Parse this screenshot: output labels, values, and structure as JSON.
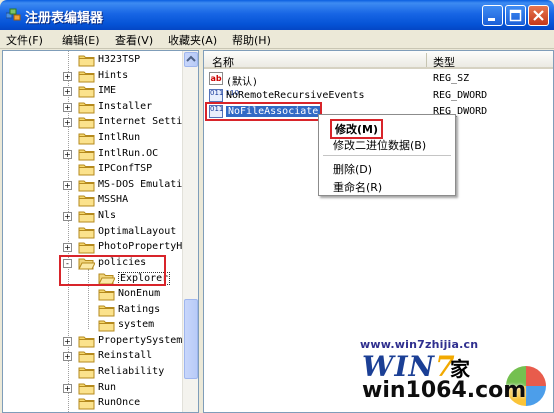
{
  "window": {
    "title": "注册表编辑器",
    "colors": {
      "title_bar": "#0a5fe0",
      "highlight_box": "#d8242a",
      "face": "#ece9d8"
    }
  },
  "menu": {
    "items": [
      {
        "label": "文件(F)"
      },
      {
        "label": "编辑(E)"
      },
      {
        "label": "查看(V)"
      },
      {
        "label": "收藏夹(A)"
      },
      {
        "label": "帮助(H)"
      }
    ]
  },
  "tree": {
    "items": [
      {
        "label": "H323TSP",
        "expander": "",
        "indent": 0
      },
      {
        "label": "Hints",
        "expander": "+",
        "indent": 0
      },
      {
        "label": "IME",
        "expander": "+",
        "indent": 0
      },
      {
        "label": "Installer",
        "expander": "+",
        "indent": 0
      },
      {
        "label": "Internet Setti",
        "expander": "+",
        "indent": 0
      },
      {
        "label": "IntlRun",
        "expander": "",
        "indent": 0
      },
      {
        "label": "IntlRun.OC",
        "expander": "+",
        "indent": 0
      },
      {
        "label": "IPConfTSP",
        "expander": "",
        "indent": 0
      },
      {
        "label": "MS-DOS Emulati",
        "expander": "+",
        "indent": 0
      },
      {
        "label": "MSSHA",
        "expander": "",
        "indent": 0
      },
      {
        "label": "Nls",
        "expander": "+",
        "indent": 0
      },
      {
        "label": "OptimalLayout",
        "expander": "",
        "indent": 0
      },
      {
        "label": "PhotoPropertyH",
        "expander": "+",
        "indent": 0
      },
      {
        "label": "policies",
        "expander": "-",
        "indent": 0,
        "open": true
      },
      {
        "label": "Explorer",
        "expander": "",
        "indent": 1,
        "selected": true,
        "open": true
      },
      {
        "label": "NonEnum",
        "expander": "",
        "indent": 1
      },
      {
        "label": "Ratings",
        "expander": "",
        "indent": 1
      },
      {
        "label": "system",
        "expander": "",
        "indent": 1
      },
      {
        "label": "PropertySystem",
        "expander": "+",
        "indent": 0
      },
      {
        "label": "Reinstall",
        "expander": "+",
        "indent": 0
      },
      {
        "label": "Reliability",
        "expander": "",
        "indent": 0
      },
      {
        "label": "Run",
        "expander": "+",
        "indent": 0
      },
      {
        "label": "RunOnce",
        "expander": "",
        "indent": 0
      }
    ]
  },
  "list": {
    "headers": {
      "name": "名称",
      "type": "类型"
    },
    "rows": [
      {
        "icon": "string-value-icon",
        "name": "(默认)",
        "type": "REG_SZ"
      },
      {
        "icon": "binary-value-icon",
        "name": "NoRemoteRecursiveEvents",
        "type": "REG_DWORD"
      },
      {
        "icon": "binary-value-icon",
        "name": "NoFileAssociate",
        "type": "REG_DWORD",
        "selected": true
      }
    ]
  },
  "context_menu": {
    "modify": "修改(M)",
    "modify_binary": "修改二进位数据(B)",
    "delete": "删除(D)",
    "rename": "重命名(R)"
  },
  "watermark": {
    "url": "www.win7zhijia.cn",
    "logo_prefix": "WIN",
    "logo_digit": "7",
    "logo_suffix": "家",
    "site": "win1064.com"
  }
}
